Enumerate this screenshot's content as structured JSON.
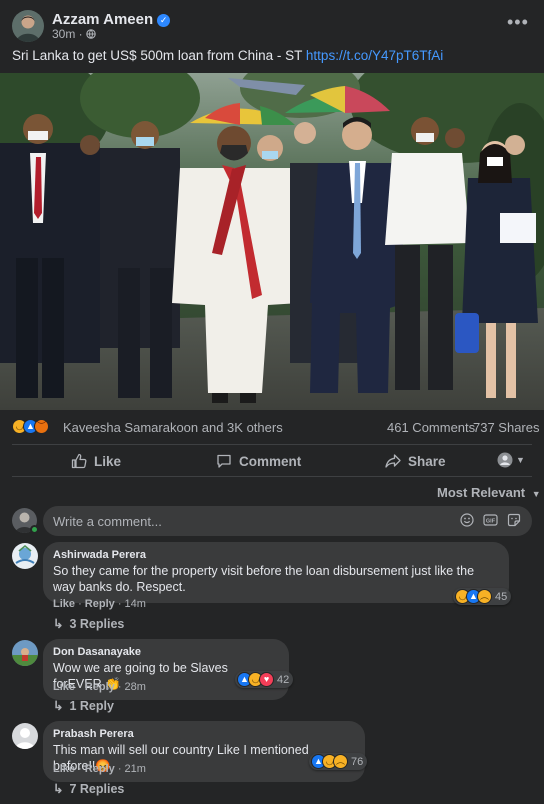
{
  "post": {
    "author": "Azzam Ameen",
    "time": "30m",
    "privacy_icon": "globe-icon",
    "text": "Sri Lanka to get US$ 500m loan from China - ST",
    "link": "https://t.co/Y47pT6TfAi",
    "more_icon": "more-horizontal-icon"
  },
  "engagement": {
    "reactions": [
      "haha",
      "like",
      "angry"
    ],
    "reactors": "Kaveesha Samarakoon and 3K others",
    "comments": "461 Comments",
    "shares": "737 Shares"
  },
  "actions": {
    "like": "Like",
    "comment": "Comment",
    "share": "Share"
  },
  "sort_label": "Most Relevant",
  "comment_input": {
    "placeholder": "Write a comment..."
  },
  "comments": [
    {
      "name": "Ashirwada Perera",
      "text": "So they came for the property visit before the loan disbursement just like the way banks do. Respect.",
      "like": "Like",
      "reply": "Reply",
      "time": "14m",
      "reactions": [
        "haha",
        "like",
        "sad"
      ],
      "reaction_count": "45",
      "replies": "3 Replies"
    },
    {
      "name": "Don Dasanayake",
      "text": "Wow we are going to be Slaves forEVER 👏",
      "like": "Like",
      "reply": "Reply",
      "time": "28m",
      "reactions": [
        "like",
        "haha",
        "love"
      ],
      "reaction_count": "42",
      "replies": "1 Reply"
    },
    {
      "name": "Prabash Perera",
      "text": "This man will sell our country Like I mentioned before!!😡",
      "like": "Like",
      "reply": "Reply",
      "time": "21m",
      "reactions": [
        "like",
        "haha",
        "sad"
      ],
      "reaction_count": "76",
      "replies": "7 Replies"
    }
  ],
  "colors": {
    "background": "#242526",
    "bubble": "#3a3b3c",
    "link": "#4599ff",
    "like_blue": "#1877f2"
  }
}
